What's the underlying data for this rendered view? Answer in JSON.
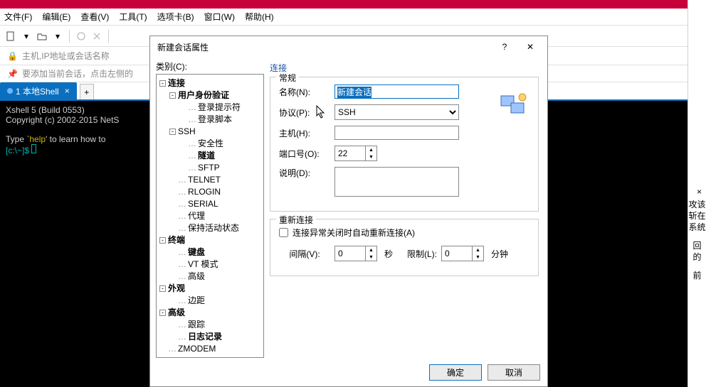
{
  "menubar": [
    "文件(F)",
    "编辑(E)",
    "查看(V)",
    "工具(T)",
    "选项卡(B)",
    "窗口(W)",
    "帮助(H)"
  ],
  "addrbar": {
    "placeholder": "主机,IP地址或会话名称"
  },
  "hintbar": {
    "text": "要添加当前会话，点击左侧的"
  },
  "tabs": {
    "active": "1 本地Shell",
    "add": "+"
  },
  "terminal": {
    "line1": "Xshell 5 (Build 0553)",
    "line2": "Copyright (c) 2002-2015 NetS",
    "line3_a": "Type `",
    "line3_b": "help",
    "line3_c": "' to learn how to",
    "prompt_a": "[c:\\~]$ "
  },
  "dialog": {
    "title": "新建会话属性",
    "tree_label": "类别(C):",
    "tree": {
      "connection": "连接",
      "auth": "用户身份验证",
      "login_prompt": "登录提示符",
      "login_script": "登录脚本",
      "ssh": "SSH",
      "security": "安全性",
      "tunnel": "隧道",
      "sftp": "SFTP",
      "telnet": "TELNET",
      "rlogin": "RLOGIN",
      "serial": "SERIAL",
      "proxy": "代理",
      "keepalive": "保持活动状态",
      "terminal": "终端",
      "keyboard": "键盘",
      "vtmode": "VT 模式",
      "advanced_term": "高级",
      "appearance": "外观",
      "margin": "边距",
      "advanced": "高级",
      "trace": "跟踪",
      "log": "日志记录",
      "zmodem": "ZMODEM"
    },
    "section_connect": "连接",
    "group_general": "常规",
    "labels": {
      "name": "名称(N):",
      "protocol": "协议(P):",
      "host": "主机(H):",
      "port": "端口号(O):",
      "desc": "说明(D):"
    },
    "values": {
      "name": "新建会话",
      "protocol": "SSH",
      "host": "",
      "port": "22",
      "desc": ""
    },
    "group_reconnect": "重新连接",
    "reconnect_chk": "连接异常关闭时自动重新连接(A)",
    "interval_label": "间隔(V):",
    "interval_value": "0",
    "interval_unit": "秒",
    "limit_label": "限制(L):",
    "limit_value": "0",
    "limit_unit": "分钟",
    "ok": "确定",
    "cancel": "取消"
  },
  "right_overlay": {
    "lines": [
      "攻该",
      "斩在",
      "系统",
      "",
      "回",
      "的",
      "",
      "前"
    ]
  }
}
